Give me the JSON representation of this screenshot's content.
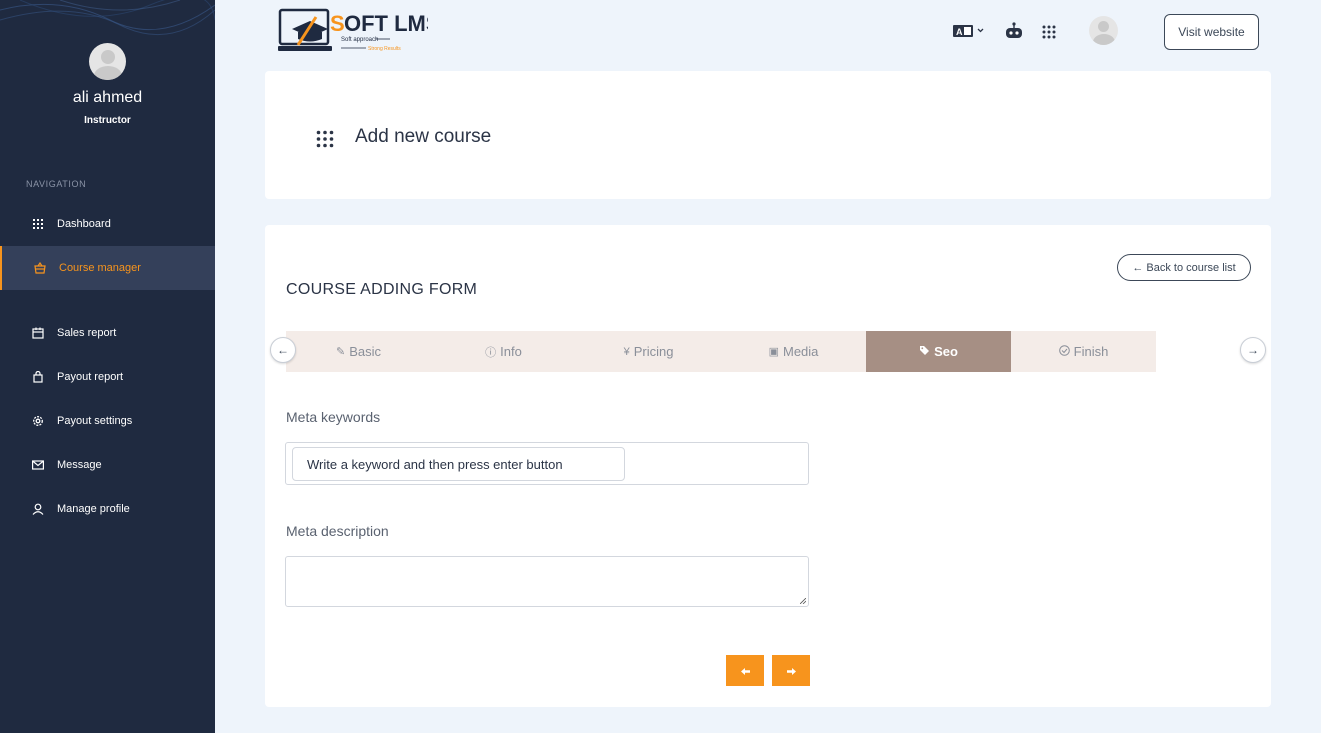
{
  "app": {
    "logo_text": "SOFT LMS",
    "logo_tagline_1": "Soft approach",
    "logo_tagline_2": "Strong Results"
  },
  "sidebar": {
    "user_name": "ali ahmed",
    "user_role": "Instructor",
    "nav_heading": "NAVIGATION",
    "items": [
      {
        "label": "Dashboard",
        "icon": "grid-icon",
        "active": false
      },
      {
        "label": "Course manager",
        "icon": "basket-icon",
        "active": true
      },
      {
        "label": "Sales report",
        "icon": "calendar-icon",
        "active": false
      },
      {
        "label": "Payout report",
        "icon": "bag-icon",
        "active": false
      },
      {
        "label": "Payout settings",
        "icon": "gear-icon",
        "active": false
      },
      {
        "label": "Message",
        "icon": "envelope-icon",
        "active": false
      },
      {
        "label": "Manage profile",
        "icon": "user-icon",
        "active": false
      }
    ]
  },
  "header": {
    "visit_website": "Visit website",
    "icons": [
      "language-icon",
      "robot-icon",
      "apps-grid-icon",
      "avatar"
    ]
  },
  "page": {
    "title": "Add new course"
  },
  "form": {
    "title": "COURSE ADDING FORM",
    "back_button": "← Back to course list",
    "tabs": [
      {
        "label": "Basic",
        "icon": "pencil-icon",
        "active": false
      },
      {
        "label": "Info",
        "icon": "info-icon",
        "active": false
      },
      {
        "label": "Pricing",
        "icon": "yen-icon",
        "active": false
      },
      {
        "label": "Media",
        "icon": "media-icon",
        "active": false
      },
      {
        "label": "Seo",
        "icon": "tag-icon",
        "active": true
      },
      {
        "label": "Finish",
        "icon": "check-circle-icon",
        "active": false
      }
    ],
    "meta_keywords_label": "Meta keywords",
    "meta_keywords_placeholder": "Write a keyword and then press enter button",
    "meta_description_label": "Meta description",
    "meta_description_value": ""
  },
  "colors": {
    "sidebar_bg": "#1f2a40",
    "accent": "#f7941d",
    "active_tab": "#a68f84",
    "tab_bg": "#f4ece8"
  }
}
